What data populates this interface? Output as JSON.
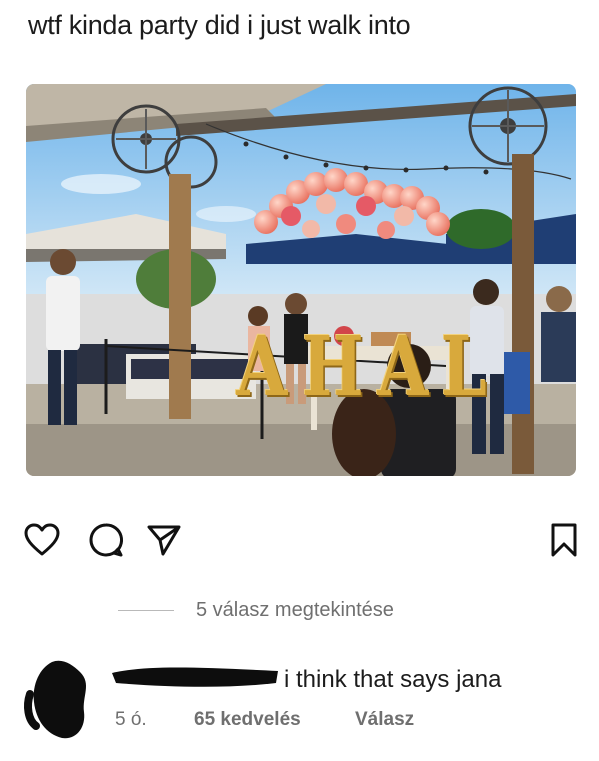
{
  "post": {
    "caption": "wtf kinda party did i just walk into",
    "balloon_text": "AHAL"
  },
  "actions": {
    "like_icon": "heart-icon",
    "comment_icon": "comment-icon",
    "share_icon": "send-icon",
    "save_icon": "bookmark-icon"
  },
  "replies": {
    "view_label": "5 válasz megtekintése"
  },
  "comment": {
    "text": "i think that says jana",
    "time": "5 ó.",
    "likes": "65 kedvelés",
    "reply_label": "Válasz"
  },
  "colors": {
    "text_primary": "#1c1c1c",
    "text_secondary": "#6f6f6f",
    "balloon_gold": "#d8a93c",
    "balloon_pink": "#f08a7e"
  }
}
